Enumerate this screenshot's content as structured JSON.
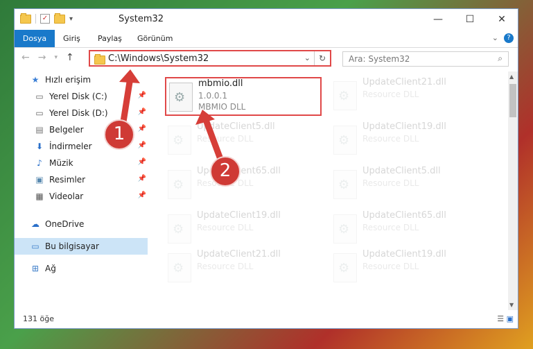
{
  "window": {
    "title": "System32"
  },
  "ribbon": {
    "tabs": [
      "Dosya",
      "Giriş",
      "Paylaş",
      "Görünüm"
    ]
  },
  "address": {
    "path": "C:\\Windows\\System32",
    "search_placeholder": "Ara: System32"
  },
  "nav": {
    "items": [
      {
        "label": "Hızlı erişim",
        "icon": "star-icon"
      },
      {
        "label": "Yerel Disk (C:)",
        "icon": "drive-icon"
      },
      {
        "label": "Yerel Disk (D:)",
        "icon": "drive-icon"
      },
      {
        "label": "Belgeler",
        "icon": "document-icon"
      },
      {
        "label": "İndirmeler",
        "icon": "download-icon"
      },
      {
        "label": "Müzik",
        "icon": "music-icon"
      },
      {
        "label": "Resimler",
        "icon": "picture-icon"
      },
      {
        "label": "Videolar",
        "icon": "video-icon"
      },
      {
        "label": "OneDrive",
        "icon": "cloud-icon"
      },
      {
        "label": "Bu bilgisayar",
        "icon": "computer-icon"
      },
      {
        "label": "Ağ",
        "icon": "network-icon"
      }
    ]
  },
  "files": {
    "main": {
      "name": "mbmio.dll",
      "version": "1.0.0.1",
      "desc": "MBMIO DLL"
    },
    "ghosts": [
      {
        "name": "UpdateClient21.dll",
        "type": "Resource DLL"
      },
      {
        "name": "UpdateClient5.dll",
        "type": "Resource DLL"
      },
      {
        "name": "UpdateClient19.dll",
        "type": "Resource DLL"
      },
      {
        "name": "UpdateClient65.dll",
        "type": "Resource DLL"
      },
      {
        "name": "UpdateClient5.dll",
        "type": "Resource DLL"
      },
      {
        "name": "UpdateClient19.dll",
        "type": "Resource DLL"
      },
      {
        "name": "UpdateClient65.dll",
        "type": "Resource DLL"
      },
      {
        "name": "UpdateClient21.dll",
        "type": "Resource DLL"
      },
      {
        "name": "UpdateClient19.dll",
        "type": "Resource DLL"
      }
    ]
  },
  "status": {
    "count": "131 öğe"
  },
  "callouts": [
    "1",
    "2"
  ]
}
